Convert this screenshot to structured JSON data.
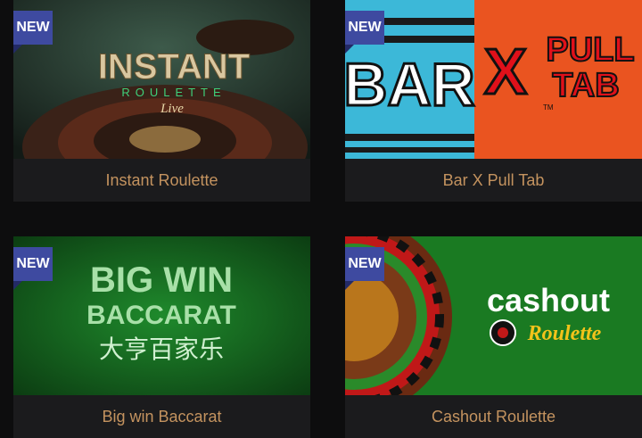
{
  "badge_text": "NEW",
  "games": [
    {
      "title": "Instant Roulette",
      "art_lines": [
        "INSTANT",
        "ROULETTE",
        "Live"
      ]
    },
    {
      "title": "Bar X Pull Tab",
      "art_lines": [
        "BAR",
        "X",
        "PULL",
        "TAB",
        "TM"
      ]
    },
    {
      "title": "Big win Baccarat",
      "art_lines": [
        "BIG WIN",
        "BACCARAT",
        "大亨百家乐"
      ]
    },
    {
      "title": "Cashout Roulette",
      "art_lines": [
        "cashout",
        "Roulette"
      ]
    }
  ],
  "colors": {
    "page_bg": "#0d0d0e",
    "card_bg": "#1b1b1d",
    "label_text": "#c4935f",
    "badge_bg": "#3e4aa0"
  }
}
